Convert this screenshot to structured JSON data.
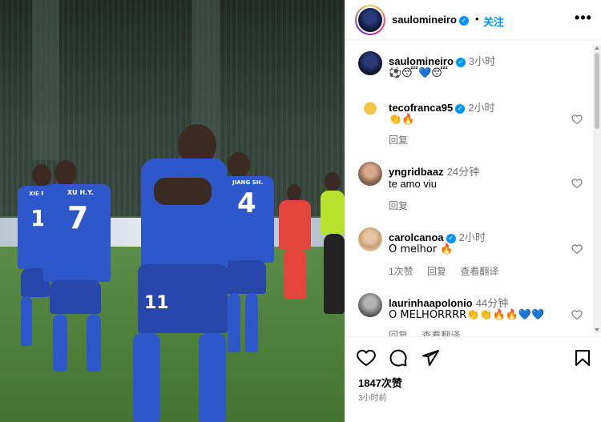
{
  "header": {
    "username": "saulomineiro",
    "follow_label": "关注",
    "more_label": "•••"
  },
  "caption": {
    "username": "saulomineiro",
    "time": "3小时",
    "text": "⚽😴💙😴"
  },
  "comments": [
    {
      "username": "tecofranca95",
      "time": "2小时",
      "text": "👏🔥",
      "actions": [
        "回复"
      ]
    },
    {
      "username": "yngridbaaz",
      "time": "24分钟",
      "text": "te amo viu",
      "actions": [
        "回复"
      ]
    },
    {
      "username": "carolcanoa",
      "time": "2小时",
      "text": "O melhor 🔥",
      "actions": [
        "1次赞",
        "回复",
        "查看翻译"
      ]
    },
    {
      "username": "laurinhaapolonio",
      "time": "44分钟",
      "text": "O MELHORRRR👏👏🔥🔥💙💙",
      "actions": [
        "回复",
        "查看翻译"
      ]
    }
  ],
  "footer": {
    "likes": "1847次赞",
    "posted": "3小时前"
  },
  "photo": {
    "jersey_numbers": [
      "1",
      "7",
      "4",
      "11"
    ],
    "name_labels": [
      "XIE P.",
      "XU H.Y.",
      "JIANG SH."
    ]
  },
  "colors": {
    "accent": "#0095f6",
    "jersey": "#2e58c9",
    "pitch": "#4f803b"
  },
  "icons": [
    "verified-icon",
    "heart-icon",
    "comment-icon",
    "share-icon",
    "bookmark-icon",
    "more-icon"
  ]
}
